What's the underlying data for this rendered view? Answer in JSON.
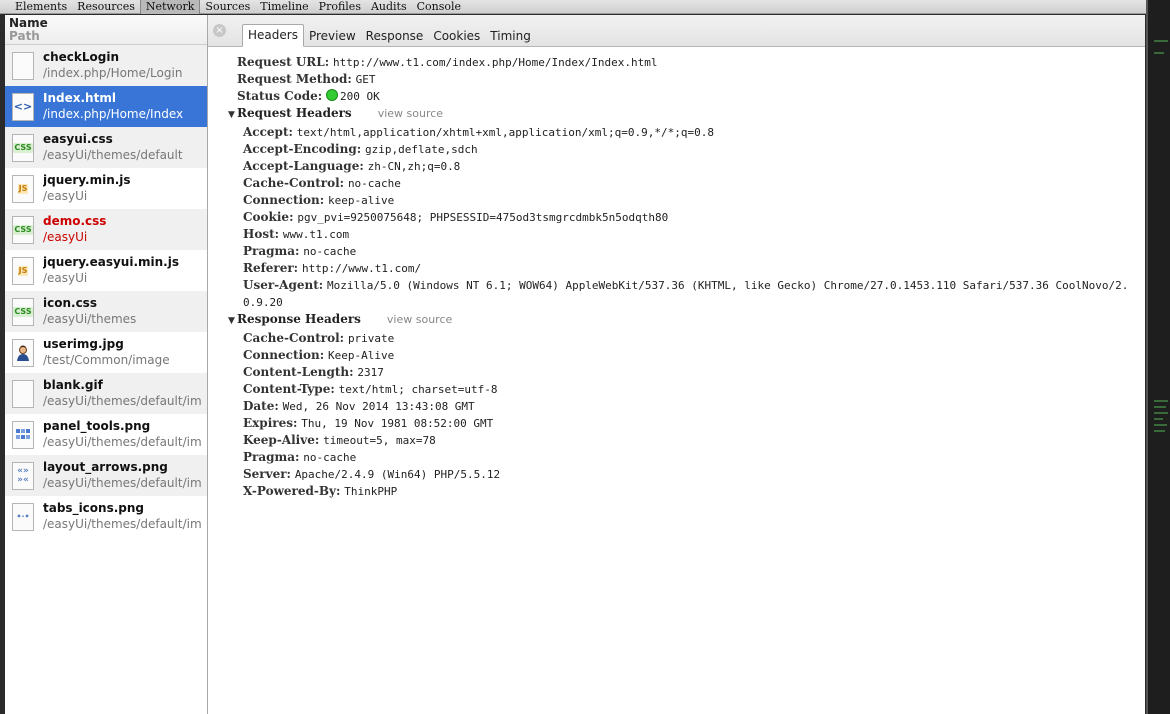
{
  "toolbar": {
    "tabs": [
      "Elements",
      "Resources",
      "Network",
      "Sources",
      "Timeline",
      "Profiles",
      "Audits",
      "Console"
    ],
    "active": "Network"
  },
  "list": {
    "header_name": "Name",
    "header_path": "Path",
    "items": [
      {
        "name": "checkLogin",
        "path": "/index.php/Home/Login",
        "icon": "blank-file-icon"
      },
      {
        "name": "Index.html",
        "path": "/index.php/Home/Index",
        "icon": "html-file-icon"
      },
      {
        "name": "easyui.css",
        "path": "/easyUi/themes/default",
        "icon": "css-file-icon"
      },
      {
        "name": "jquery.min.js",
        "path": "/easyUi",
        "icon": "js-file-icon"
      },
      {
        "name": "demo.css",
        "path": "/easyUi",
        "icon": "css-file-icon"
      },
      {
        "name": "jquery.easyui.min.js",
        "path": "/easyUi",
        "icon": "js-file-icon"
      },
      {
        "name": "icon.css",
        "path": "/easyUi/themes",
        "icon": "css-file-icon"
      },
      {
        "name": "userimg.jpg",
        "path": "/test/Common/image",
        "icon": "user-image-icon"
      },
      {
        "name": "blank.gif",
        "path": "/easyUi/themes/default/im",
        "icon": "blank-file-icon"
      },
      {
        "name": "panel_tools.png",
        "path": "/easyUi/themes/default/im",
        "icon": "image-file-icon"
      },
      {
        "name": "layout_arrows.png",
        "path": "/easyUi/themes/default/im",
        "icon": "arrows-image-icon"
      },
      {
        "name": "tabs_icons.png",
        "path": "/easyUi/themes/default/im",
        "icon": "dots-image-icon"
      }
    ]
  },
  "panel": {
    "tabs": [
      "Headers",
      "Preview",
      "Response",
      "Cookies",
      "Timing"
    ],
    "active_tab": "Headers",
    "general": [
      {
        "k": "Request URL:",
        "v": "http://www.t1.com/index.php/Home/Index/Index.html"
      },
      {
        "k": "Request Method:",
        "v": "GET"
      },
      {
        "k": "Status Code:",
        "v": "200 OK"
      }
    ],
    "request_headers_title": "Request Headers",
    "response_headers_title": "Response Headers",
    "view_source": "view source",
    "request_headers": [
      {
        "k": "Accept:",
        "v": "text/html,application/xhtml+xml,application/xml;q=0.9,*/*;q=0.8"
      },
      {
        "k": "Accept-Encoding:",
        "v": "gzip,deflate,sdch"
      },
      {
        "k": "Accept-Language:",
        "v": "zh-CN,zh;q=0.8"
      },
      {
        "k": "Cache-Control:",
        "v": "no-cache"
      },
      {
        "k": "Connection:",
        "v": "keep-alive"
      },
      {
        "k": "Cookie:",
        "v": "pgv_pvi=9250075648; PHPSESSID=475od3tsmgrcdmbk5n5odqth80"
      },
      {
        "k": "Host:",
        "v": "www.t1.com"
      },
      {
        "k": "Pragma:",
        "v": "no-cache"
      },
      {
        "k": "Referer:",
        "v": "http://www.t1.com/"
      },
      {
        "k": "User-Agent:",
        "v": "Mozilla/5.0 (Windows NT 6.1; WOW64) AppleWebKit/537.36 (KHTML, like Gecko) Chrome/27.0.1453.110 Safari/537.36 CoolNovo/2.0.9.20"
      }
    ],
    "response_headers": [
      {
        "k": "Cache-Control:",
        "v": "private"
      },
      {
        "k": "Connection:",
        "v": "Keep-Alive"
      },
      {
        "k": "Content-Length:",
        "v": "2317"
      },
      {
        "k": "Content-Type:",
        "v": "text/html; charset=utf-8"
      },
      {
        "k": "Date:",
        "v": "Wed, 26 Nov 2014 13:43:08 GMT"
      },
      {
        "k": "Expires:",
        "v": "Thu, 19 Nov 1981 08:52:00 GMT"
      },
      {
        "k": "Keep-Alive:",
        "v": "timeout=5, max=78"
      },
      {
        "k": "Pragma:",
        "v": "no-cache"
      },
      {
        "k": "Server:",
        "v": "Apache/2.4.9 (Win64) PHP/5.5.12"
      },
      {
        "k": "X-Powered-By:",
        "v": "ThinkPHP"
      }
    ]
  },
  "colors": {
    "selected_row": "#3875d7",
    "error_text": "#cc0000",
    "status_ok": "#33cc33"
  }
}
